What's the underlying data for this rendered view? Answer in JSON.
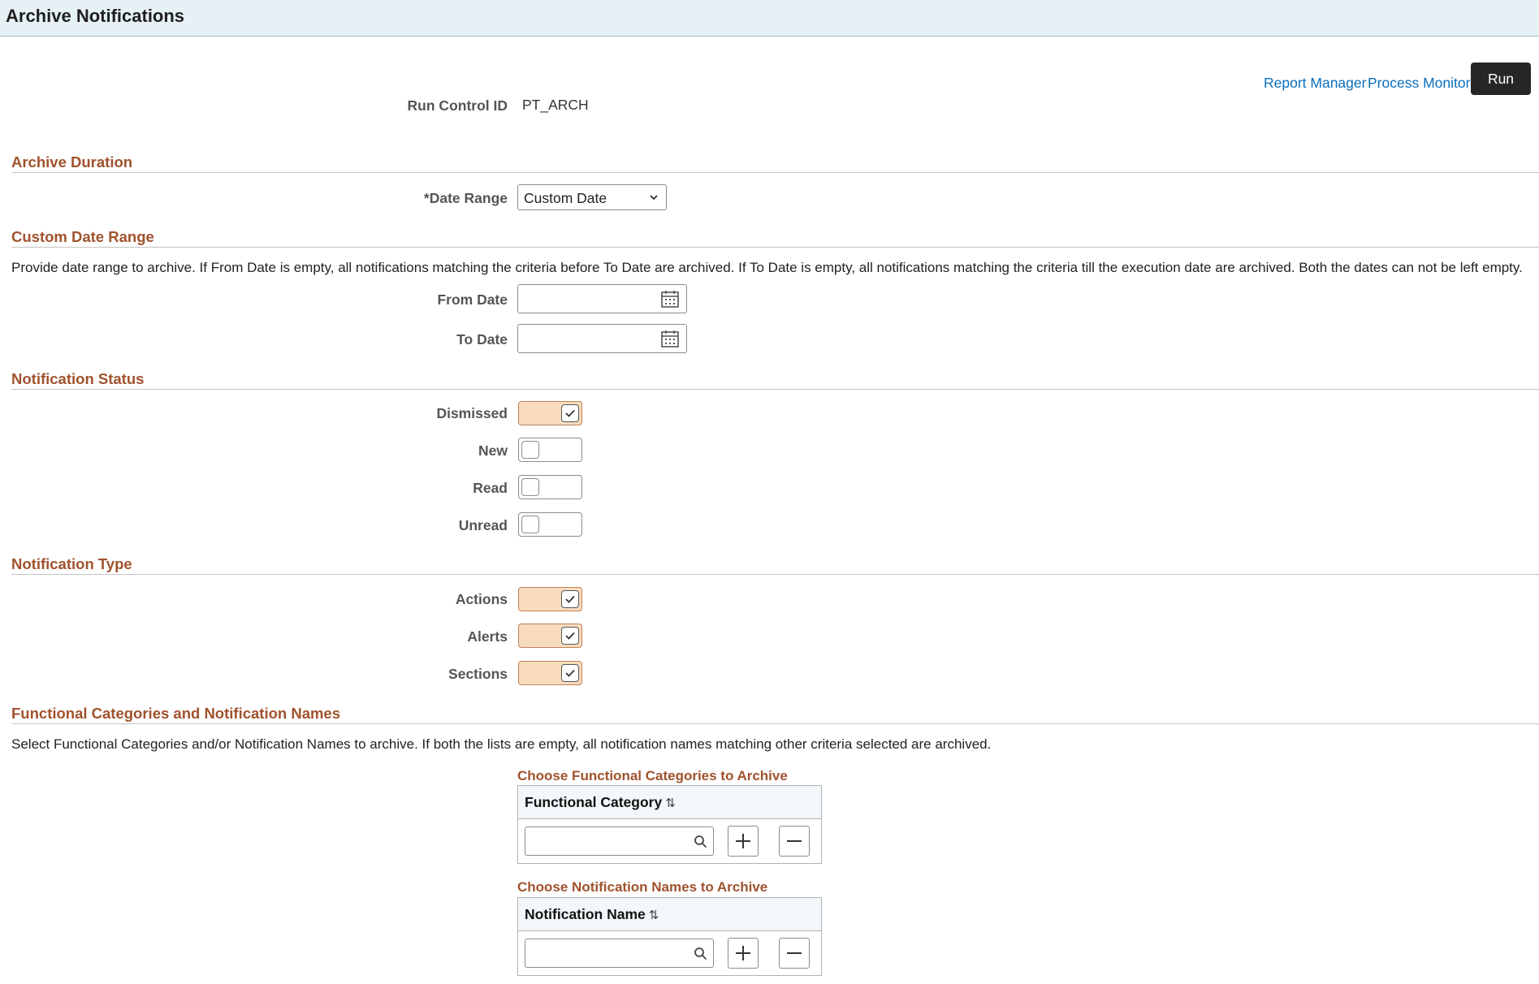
{
  "header": {
    "title": "Archive Notifications"
  },
  "actions": {
    "report_manager": "Report Manager",
    "process_monitor": "Process Monitor",
    "run": "Run"
  },
  "run_control": {
    "label": "Run Control ID",
    "value": "PT_ARCH"
  },
  "archive_duration": {
    "title": "Archive Duration",
    "date_range_label": "*Date Range",
    "date_range_value": "Custom Date"
  },
  "custom_date_range": {
    "title": "Custom Date Range",
    "description": "Provide date range to archive. If From Date is empty, all notifications matching the criteria before To Date are archived. If To Date is empty, all notifications matching the criteria till the execution date are archived. Both the dates can not be left empty.",
    "from_label": "From Date",
    "from_value": "",
    "to_label": "To Date",
    "to_value": ""
  },
  "notification_status": {
    "title": "Notification Status",
    "items": [
      {
        "label": "Dismissed",
        "checked": true
      },
      {
        "label": "New",
        "checked": false
      },
      {
        "label": "Read",
        "checked": false
      },
      {
        "label": "Unread",
        "checked": false
      }
    ]
  },
  "notification_type": {
    "title": "Notification Type",
    "items": [
      {
        "label": "Actions",
        "checked": true
      },
      {
        "label": "Alerts",
        "checked": true
      },
      {
        "label": "Sections",
        "checked": true
      }
    ]
  },
  "functional": {
    "title": "Functional Categories and Notification Names",
    "description": "Select Functional Categories and/or Notification Names to archive. If both the lists are empty, all notification names matching other criteria selected are archived.",
    "categories": {
      "title": "Choose Functional Categories to Archive",
      "column": "Functional Category",
      "value": ""
    },
    "names": {
      "title": "Choose Notification Names to Archive",
      "column": "Notification Name",
      "value": ""
    }
  },
  "colors": {
    "accent": "#a0522d",
    "link": "#0a6ebd",
    "toggle_on": "#f8dcbd",
    "header_bg": "#e6f1f5"
  },
  "icons": [
    "chevron-down-icon",
    "calendar-icon",
    "checkmark-icon",
    "search-icon",
    "plus-icon",
    "minus-icon",
    "sort-icon"
  ]
}
